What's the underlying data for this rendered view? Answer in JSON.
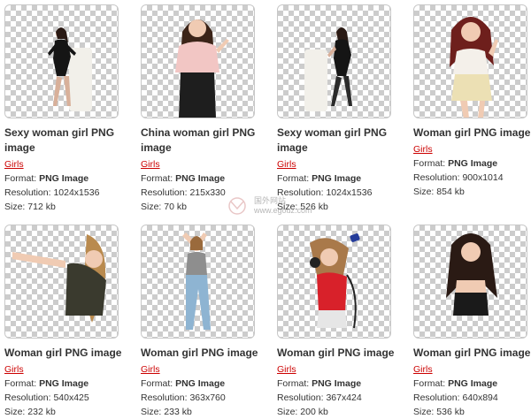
{
  "cards": [
    {
      "title": "Sexy woman girl PNG image",
      "category": "Girls",
      "format_label": "Format:",
      "format": "PNG Image",
      "resolution_label": "Resolution:",
      "resolution": "1024x1536",
      "size_label": "Size:",
      "size": "712 kb"
    },
    {
      "title": "China woman girl PNG image",
      "category": "Girls",
      "format_label": "Format:",
      "format": "PNG Image",
      "resolution_label": "Resolution:",
      "resolution": "215x330",
      "size_label": "Size:",
      "size": "70 kb"
    },
    {
      "title": "Sexy woman girl PNG image",
      "category": "Girls",
      "format_label": "Format:",
      "format": "PNG Image",
      "resolution_label": "Resolution:",
      "resolution": "1024x1536",
      "size_label": "Size:",
      "size": "526 kb"
    },
    {
      "title": "Woman girl PNG image",
      "category": "Girls",
      "format_label": "Format:",
      "format": "PNG Image",
      "resolution_label": "Resolution:",
      "resolution": "900x1014",
      "size_label": "Size:",
      "size": "854 kb"
    },
    {
      "title": "Woman girl PNG image",
      "category": "Girls",
      "format_label": "Format:",
      "format": "PNG Image",
      "resolution_label": "Resolution:",
      "resolution": "540x425",
      "size_label": "Size:",
      "size": "232 kb"
    },
    {
      "title": "Woman girl PNG image",
      "category": "Girls",
      "format_label": "Format:",
      "format": "PNG Image",
      "resolution_label": "Resolution:",
      "resolution": "363x760",
      "size_label": "Size:",
      "size": "233 kb"
    },
    {
      "title": "Woman girl PNG image",
      "category": "Girls",
      "format_label": "Format:",
      "format": "PNG Image",
      "resolution_label": "Resolution:",
      "resolution": "367x424",
      "size_label": "Size:",
      "size": "200 kb"
    },
    {
      "title": "Woman girl PNG image",
      "category": "Girls",
      "format_label": "Format:",
      "format": "PNG Image",
      "resolution_label": "Resolution:",
      "resolution": "640x894",
      "size_label": "Size:",
      "size": "536 kb"
    }
  ],
  "watermark": {
    "line1": "国外网站",
    "line2": "www.egouz.com"
  },
  "colors": {
    "category_link": "#cc0000",
    "thumb_border": "#c8c8c8",
    "checker": "#cccccc"
  }
}
